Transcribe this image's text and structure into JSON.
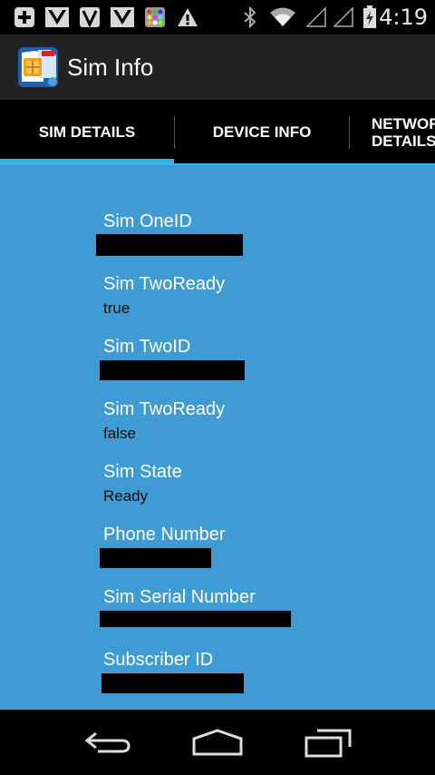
{
  "status_bar": {
    "time": "4:19",
    "icons": [
      "plus-notification-icon",
      "app-notification-icon",
      "vine-icon",
      "app-notification-icon",
      "grid-app-icon",
      "warning-icon",
      "bluetooth-icon",
      "wifi-icon",
      "signal-icon",
      "signal-icon",
      "battery-icon"
    ]
  },
  "app_bar": {
    "title": "Sim Info",
    "icon": "sim-card-app-icon"
  },
  "tabs": [
    {
      "label": "SIM DETAILS",
      "selected": true
    },
    {
      "label": "DEVICE INFO",
      "selected": false
    },
    {
      "label": "NETWORK\nDETAILS",
      "selected": false
    }
  ],
  "fields": [
    {
      "label": "Sim OneID",
      "value": "",
      "redacted": true
    },
    {
      "label": "Sim TwoReady",
      "value": "true",
      "redacted": false
    },
    {
      "label": "Sim TwoID",
      "value": "",
      "redacted": true
    },
    {
      "label": "Sim TwoReady",
      "value": "false",
      "redacted": false
    },
    {
      "label": "Sim State",
      "value": "Ready",
      "redacted": false
    },
    {
      "label": "Phone Number",
      "value": "",
      "redacted": true
    },
    {
      "label": "Sim Serial Number",
      "value": "",
      "redacted": true
    },
    {
      "label": "Subscriber ID",
      "value": "",
      "redacted": true
    }
  ],
  "nav_bar": {
    "buttons": [
      "back-icon",
      "home-icon",
      "recent-apps-icon"
    ]
  },
  "colors": {
    "content_background": "#3f9bd3",
    "tab_indicator": "#33b5e5",
    "action_bar": "#222222"
  }
}
